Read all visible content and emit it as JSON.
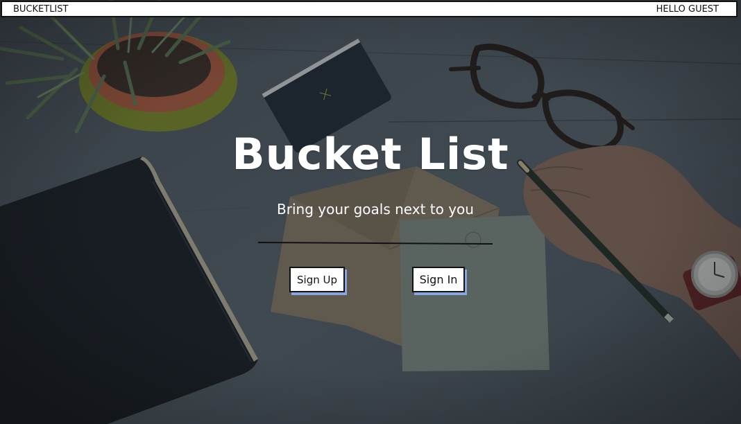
{
  "header": {
    "brand": "BUCKETLIST",
    "greeting": "HELLO GUEST"
  },
  "hero": {
    "title": "Bucket List",
    "subtitle": "Bring your goals next to you"
  },
  "actions": {
    "sign_up_label": "Sign Up",
    "sign_in_label": "Sign In"
  },
  "colors": {
    "button_shadow": "#8aa5dd",
    "overlay": "#2c333b",
    "text": "#ffffff"
  }
}
